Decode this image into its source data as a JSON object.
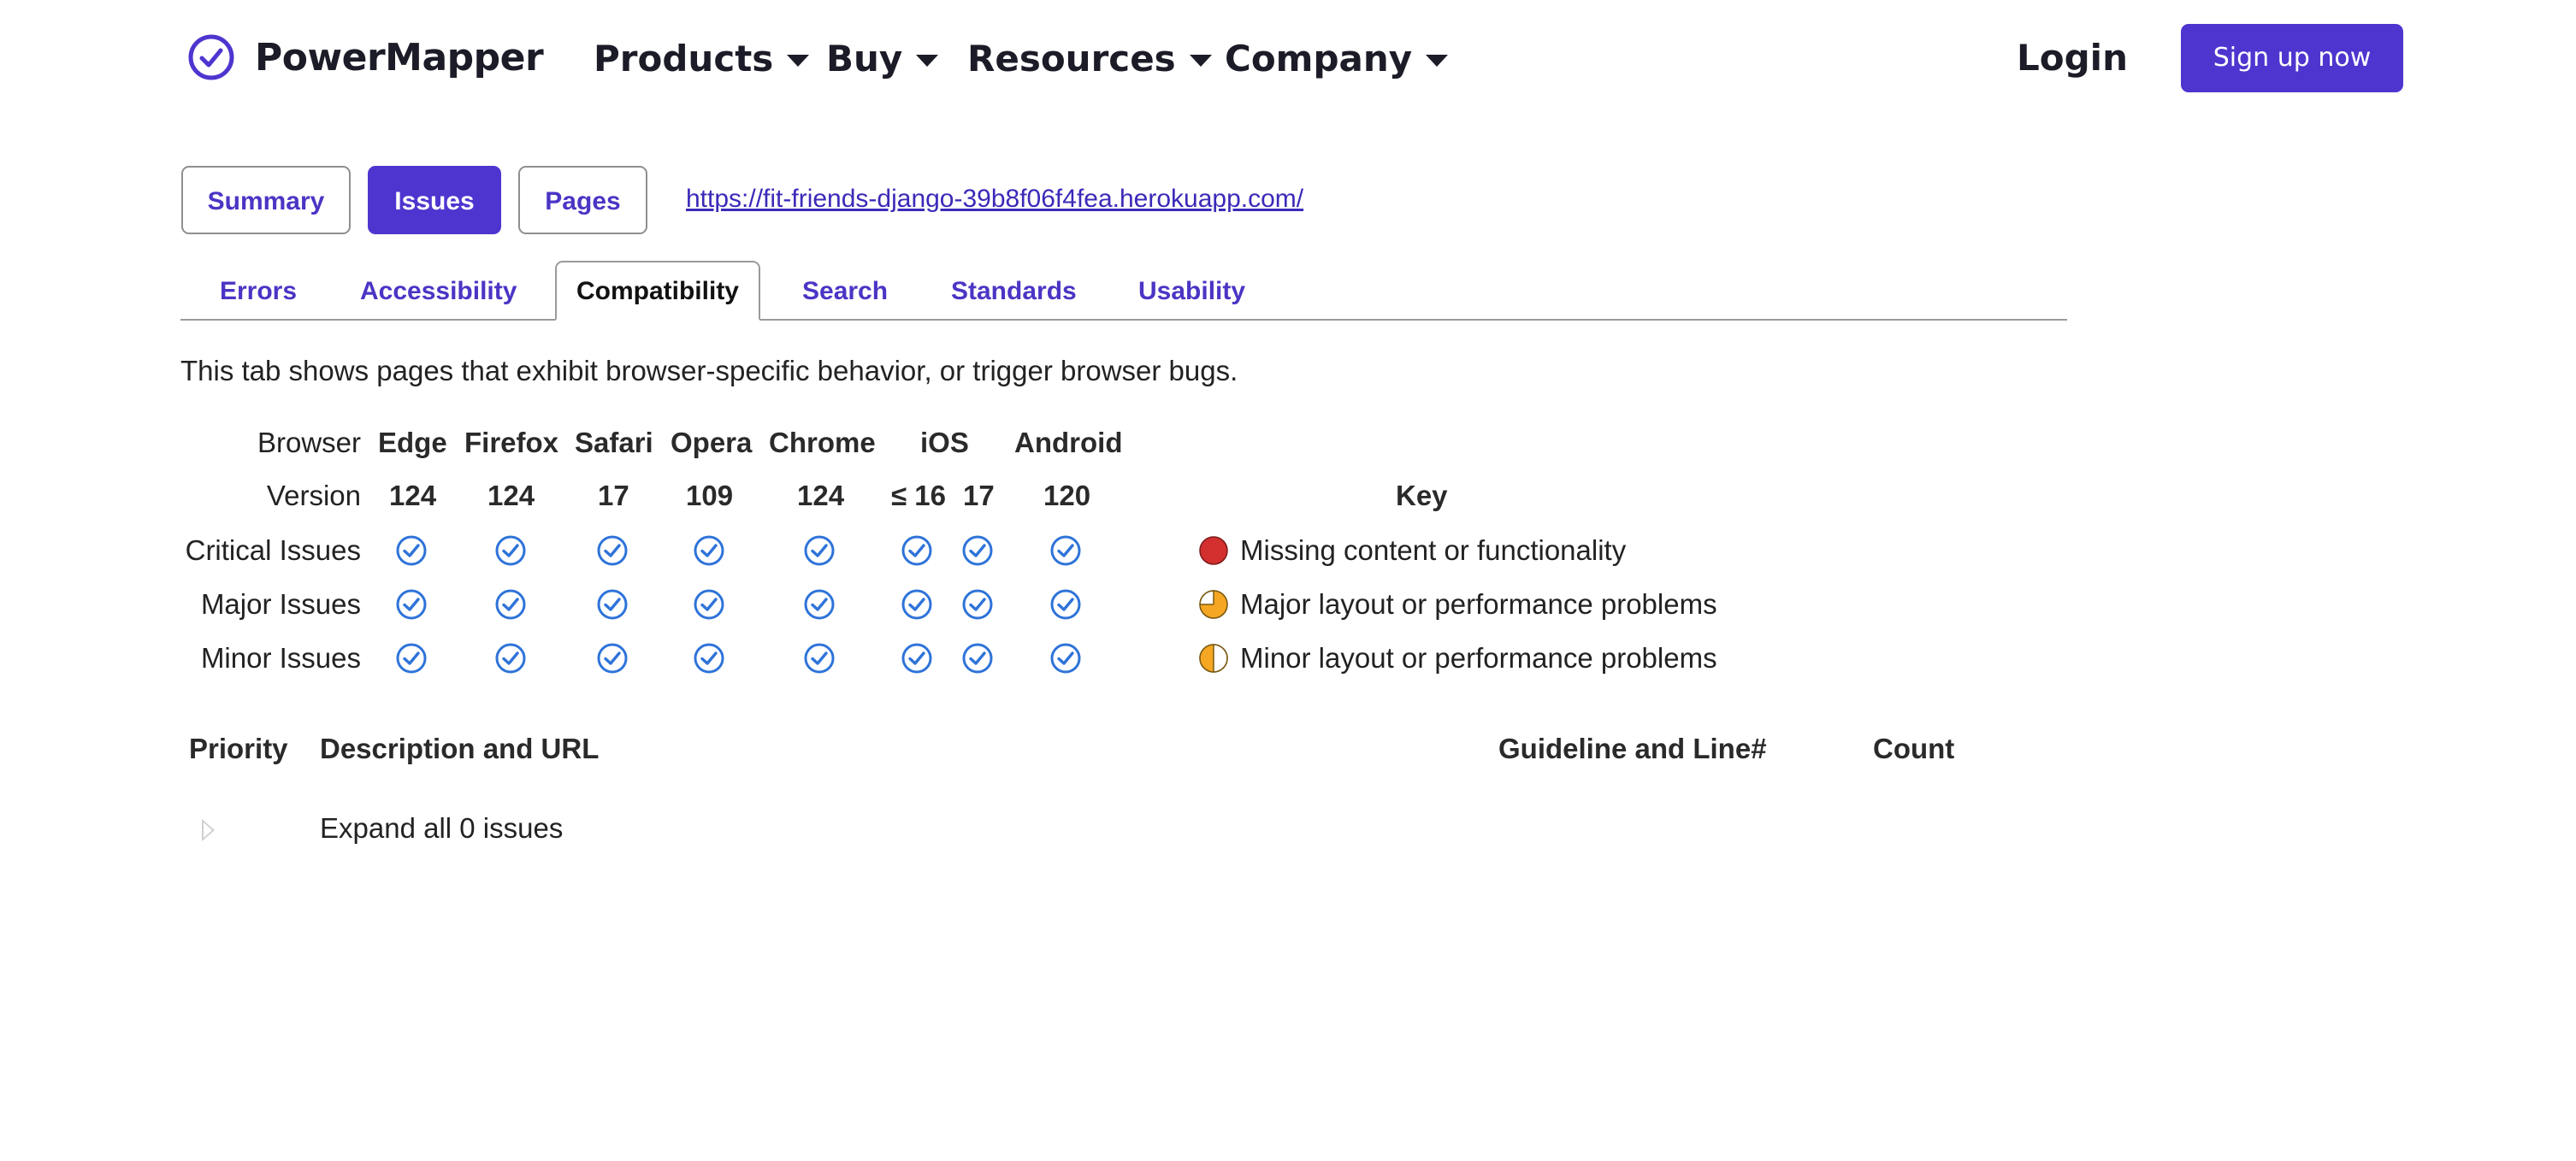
{
  "brand": {
    "name": "PowerMapper",
    "color": "#4f35cf"
  },
  "nav": {
    "items": [
      {
        "label": "Products"
      },
      {
        "label": "Buy"
      },
      {
        "label": "Resources"
      },
      {
        "label": "Company"
      }
    ],
    "login": "Login",
    "signup": "Sign up now"
  },
  "views": [
    {
      "label": "Summary",
      "active": false
    },
    {
      "label": "Issues",
      "active": true
    },
    {
      "label": "Pages",
      "active": false
    }
  ],
  "site_url": "https://fit-friends-django-39b8f06f4fea.herokuapp.com/",
  "tabs": [
    {
      "label": "Errors",
      "active": false
    },
    {
      "label": "Accessibility",
      "active": false
    },
    {
      "label": "Compatibility",
      "active": true
    },
    {
      "label": "Search",
      "active": false
    },
    {
      "label": "Standards",
      "active": false
    },
    {
      "label": "Usability",
      "active": false
    }
  ],
  "intro": "This tab shows pages that exhibit browser-specific behavior, or trigger browser bugs.",
  "grid": {
    "browser_label": "Browser",
    "version_label": "Version",
    "browsers": [
      {
        "name": "Edge",
        "versions": [
          "124"
        ]
      },
      {
        "name": "Firefox",
        "versions": [
          "124"
        ]
      },
      {
        "name": "Safari",
        "versions": [
          "17"
        ]
      },
      {
        "name": "Opera",
        "versions": [
          "109"
        ]
      },
      {
        "name": "Chrome",
        "versions": [
          "124"
        ]
      },
      {
        "name": "iOS",
        "versions": [
          "≤ 16",
          "17"
        ]
      },
      {
        "name": "Android",
        "versions": [
          "120"
        ]
      }
    ],
    "rows": [
      {
        "label": "Critical Issues",
        "status": "pass"
      },
      {
        "label": "Major Issues",
        "status": "pass"
      },
      {
        "label": "Minor Issues",
        "status": "pass"
      }
    ]
  },
  "key": {
    "title": "Key",
    "items": [
      {
        "icon": "red-circle-icon",
        "color": "#d32f2f",
        "text": "Missing content or functionality"
      },
      {
        "icon": "orange-three-quarter-pie-icon",
        "color": "#f5a623",
        "text": "Major layout or performance problems"
      },
      {
        "icon": "orange-half-pie-icon",
        "color": "#f5a623",
        "text": "Minor layout or performance problems"
      }
    ]
  },
  "issues_table": {
    "headers": {
      "priority": "Priority",
      "description": "Description and URL",
      "guideline": "Guideline and Line#",
      "count": "Count"
    },
    "expand_label": "Expand all 0 issues"
  }
}
